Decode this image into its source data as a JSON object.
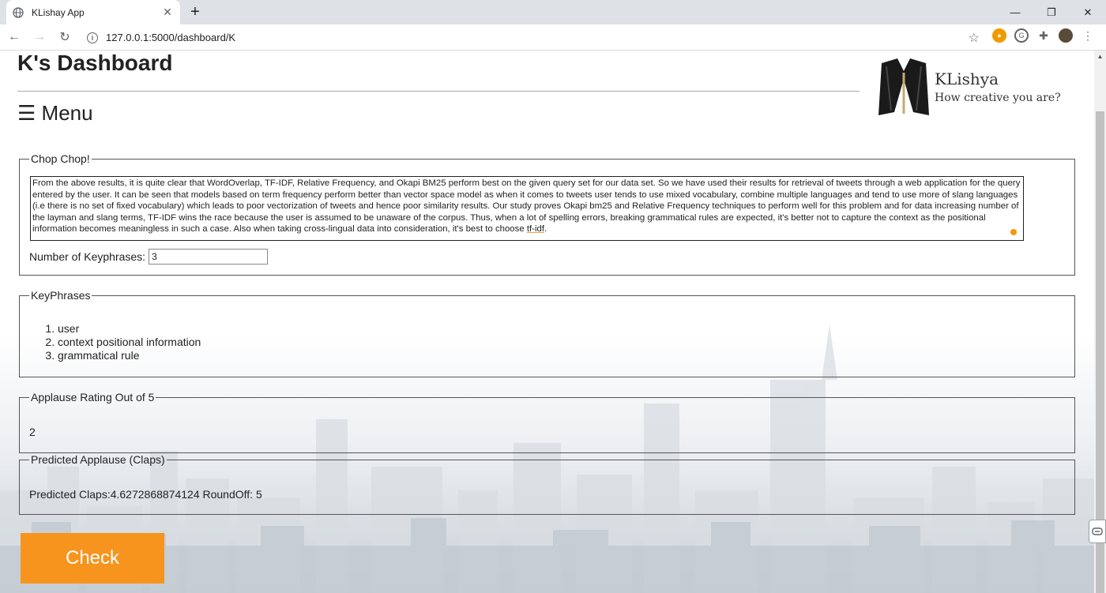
{
  "browser": {
    "tab_title": "KLishay App",
    "url": "127.0.0.1:5000/dashboard/K"
  },
  "page": {
    "title": "K's Dashboard",
    "menu_label": "☰ Menu",
    "logo": {
      "name": "KLishya",
      "tagline": "How creative you are?"
    }
  },
  "chop": {
    "legend": "Chop Chop!",
    "text": "From the above results, it is quite clear that WordOverlap, TF-IDF, Relative Frequency, and Okapi BM25 perform best on the given query set for our data set. So we have used their results for retrieval of tweets through a web application for the query entered by the user. It can be seen that models based on term frequency perform better than vector space model as when it comes to tweets user tends to use mixed vocabulary, combine multiple languages and tend to use more of slang languages (i.e there is no set of fixed vocabulary) which leads to poor vectorization of tweets and hence poor similarity results. Our study proves Okapi bm25 and Relative Frequency techniques to perform well for this problem and for data increasing number of the layman and slang terms, TF-IDF wins the race because the user is assumed to be unaware of the corpus. Thus, when a lot of spelling errors, breaking grammatical rules are expected, it's better not to capture the context as the positional information becomes meaningless in such a case. Also when taking cross-lingual data into consideration, it's best to choose ",
    "text_end": "tf-idf",
    "text_tail": ".",
    "keyphrase_label": "Number of Keyphrases:",
    "keyphrase_value": "3"
  },
  "keyphrases": {
    "legend": "KeyPhrases",
    "items": [
      "user",
      "context positional information",
      "grammatical rule"
    ]
  },
  "rating": {
    "legend": "Applause Rating Out of 5",
    "value": "2"
  },
  "predicted": {
    "legend": "Predicted Applause (Claps)",
    "value": "Predicted Claps:4.6272868874124 RoundOff: 5"
  },
  "check_label": "Check",
  "colors": {
    "accent": "#f7941d"
  }
}
